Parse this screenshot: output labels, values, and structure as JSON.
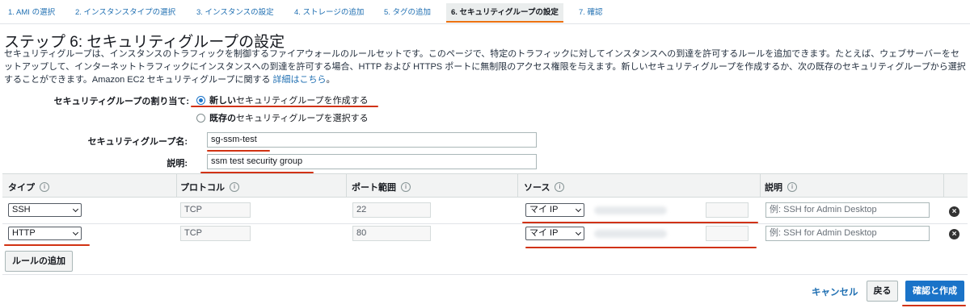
{
  "wizard": {
    "steps": [
      "1. AMI の選択",
      "2. インスタンスタイプの選択",
      "3. インスタンスの設定",
      "4. ストレージの追加",
      "5. タグの追加",
      "6. セキュリティグループの設定",
      "7. 確認"
    ],
    "active_index": 5
  },
  "page": {
    "title": "ステップ 6: セキュリティグループの設定",
    "description": "セキュリティグループは、インスタンスのトラフィックを制御するファイアウォールのルールセットです。このページで、特定のトラフィックに対してインスタンスへの到達を許可するルールを追加できます。たとえば、ウェブサーバーをセットアップして、インターネットトラフィックにインスタンスへの到達を許可する場合、HTTP および HTTPS ポートに無制限のアクセス権限を与えます。新しいセキュリティグループを作成するか、次の既存のセキュリティグループから選択することができます。Amazon EC2 セキュリティグループに関する",
    "details_link": "詳細はこちら",
    "details_suffix": "。"
  },
  "assign": {
    "label": "セキュリティグループの割り当て:",
    "option_new_bold": "新しい",
    "option_new_rest": "セキュリティグループを作成する",
    "option_existing_bold": "既存の",
    "option_existing_rest": "セキュリティグループを選択する",
    "selected": "new"
  },
  "form": {
    "name_label": "セキュリティグループ名:",
    "name_value": "sg-ssm-test",
    "desc_label": "説明:",
    "desc_value": "ssm test security group"
  },
  "table": {
    "headers": [
      "タイプ",
      "プロトコル",
      "ポート範囲",
      "ソース",
      "説明"
    ],
    "info_icon": "i",
    "rows": [
      {
        "type": "SSH",
        "protocol": "TCP",
        "port": "22",
        "source": "マイ IP",
        "description_placeholder": "例: SSH for Admin Desktop"
      },
      {
        "type": "HTTP",
        "protocol": "TCP",
        "port": "80",
        "source": "マイ IP",
        "description_placeholder": "例: SSH for Admin Desktop"
      }
    ],
    "delete_icon": "×"
  },
  "buttons": {
    "add_rule": "ルールの追加",
    "cancel": "キャンセル",
    "back": "戻る",
    "review_launch": "確認と作成"
  },
  "colors": {
    "accent": "#1a73c8",
    "annotation": "#d13212",
    "active_tab_border": "#ec7211"
  }
}
